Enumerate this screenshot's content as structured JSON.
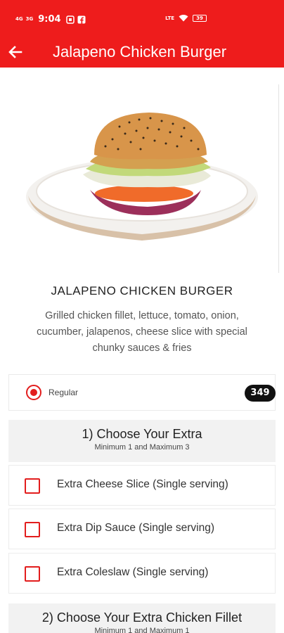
{
  "status_bar": {
    "time": "9:04",
    "network_left_1": "4G",
    "network_left_2": "3G",
    "network_right": "LTE",
    "battery": "39"
  },
  "app_bar": {
    "title": "Jalapeno Chicken Burger"
  },
  "product": {
    "name": "JALAPENO CHICKEN BURGER",
    "description": "Grilled chicken fillet, lettuce, tomato, onion, cucumber, jalapenos, cheese slice with special chunky sauces & fries"
  },
  "size_option": {
    "label": "Regular",
    "price": "349",
    "selected": true
  },
  "extras_section": {
    "title": "1) Choose Your Extra",
    "subtitle": "Minimum 1 and Maximum 3",
    "options": [
      {
        "label": "Extra Cheese Slice (Single serving)",
        "checked": false
      },
      {
        "label": "Extra Dip Sauce (Single serving)",
        "checked": false
      },
      {
        "label": "Extra Coleslaw (Single serving)",
        "checked": false
      }
    ]
  },
  "chicken_section": {
    "title": "2) Choose Your Extra Chicken Fillet",
    "subtitle": "Minimum 1 and Maximum 1"
  },
  "colors": {
    "brand_red": "#ee1c1c",
    "accent_red": "#e21d1d",
    "badge_black": "#111111"
  }
}
